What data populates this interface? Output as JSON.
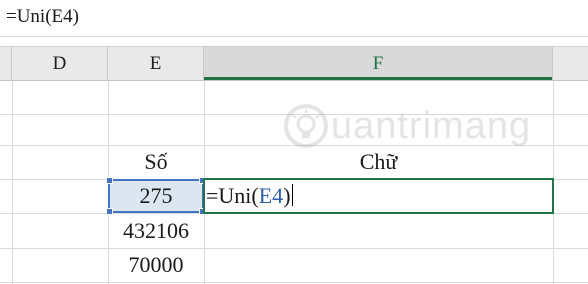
{
  "formula_bar": {
    "content": "=Uni(E4)"
  },
  "columns": {
    "d": "D",
    "e": "E",
    "f": "F"
  },
  "cells": {
    "e3": "Số",
    "f3": "Chữ",
    "e4": "275",
    "e5": "432106",
    "e6": "70000"
  },
  "editing_cell": {
    "prefix": "=Uni(",
    "ref": "E4",
    "suffix": ")"
  },
  "watermark": {
    "text": "uantrimang",
    "icon": "lightbulb-logo-icon"
  },
  "colors": {
    "selected_header": "#217346",
    "reference_highlight": "#4472c4",
    "selected_cell_fill": "#dce6f1"
  }
}
